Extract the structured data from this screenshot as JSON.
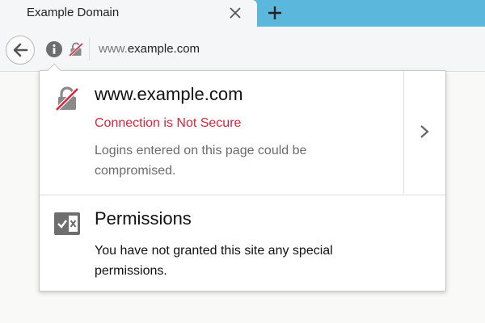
{
  "tab": {
    "title": "Example Domain",
    "close_icon": "close-icon",
    "new_tab_icon": "plus-icon"
  },
  "navbar": {
    "back_icon": "back-arrow-icon",
    "identity_icon": "info-icon",
    "insecure_icon": "insecure-lock-icon",
    "url": {
      "prefix": "www.",
      "domain": "example.com"
    }
  },
  "popup": {
    "security": {
      "host": "www.example.com",
      "status": "Connection is Not Secure",
      "description": "Logins entered on this page could be compromised.",
      "expand_icon": "chevron-right-icon"
    },
    "permissions": {
      "title": "Permissions",
      "description": "You have not granted this site any special permissions."
    }
  },
  "colors": {
    "tabstrip": "#5bb8dc",
    "insecure_red": "#d7263d",
    "icon_gray": "#6e6e6e"
  }
}
